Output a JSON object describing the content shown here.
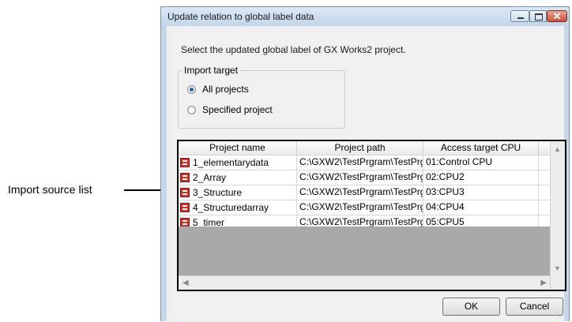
{
  "callout": {
    "label": "Import source list"
  },
  "window": {
    "title": "Update relation to global label data",
    "instruction": "Select the updated global label of GX Works2 project."
  },
  "import_target": {
    "legend": "Import target",
    "options": [
      {
        "label": "All projects",
        "selected": true
      },
      {
        "label": "Specified project",
        "selected": false
      }
    ]
  },
  "list": {
    "columns": [
      "Project name",
      "Project path",
      "Access target CPU"
    ],
    "rows": [
      {
        "name": "1_elementarydata",
        "path": "C:\\GXW2\\TestPrgram\\TestPrgra",
        "cpu": "01:Control CPU"
      },
      {
        "name": "2_Array",
        "path": "C:\\GXW2\\TestPrgram\\TestPrgra",
        "cpu": "02:CPU2"
      },
      {
        "name": "3_Structure",
        "path": "C:\\GXW2\\TestPrgram\\TestPrgra",
        "cpu": "03:CPU3"
      },
      {
        "name": "4_Structuredarray",
        "path": "C:\\GXW2\\TestPrgram\\TestPrgra",
        "cpu": "04:CPU4"
      },
      {
        "name": "5_timer",
        "path": "C:\\GXW2\\TestPrgram\\TestPrgra",
        "cpu": "05:CPU5"
      }
    ]
  },
  "buttons": {
    "ok": "OK",
    "cancel": "Cancel"
  }
}
